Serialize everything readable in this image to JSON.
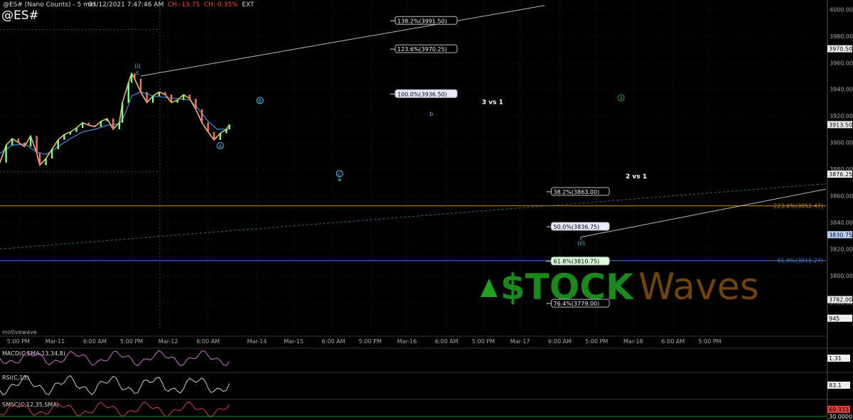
{
  "header": {
    "title": "@ES# (Nano Counts) - 5 min",
    "datetime": "03/12/2021 7:47:46 AM",
    "change": "CH:-13.75",
    "change_pct": "CH:-0.35%",
    "session": "EXT",
    "symbol": "@ES#"
  },
  "colors": {
    "background": "#000000",
    "up": "#7cff7c",
    "down": "#ff7070",
    "fib_box_border": "#cccccc",
    "orange_line": "#c88a1a",
    "blue_line": "#4a7bd0",
    "wave_label": "#4fc3f7",
    "watermark_green": "#1fa01f",
    "watermark_brown": "#7a4b10"
  },
  "watermark": {
    "site": "motivewave",
    "brand_left": "$TOCK",
    "brand_right": "Waves"
  },
  "chart_data": {
    "type": "candlestick",
    "y_axis": {
      "range": [
        3762,
        4005
      ],
      "ticks": [
        "4000.00",
        "3980.00",
        "3960.00",
        "3940.00",
        "3920.00",
        "3900.00",
        "3880.00",
        "3860.00",
        "3840.00",
        "3820.00",
        "3800.00",
        "3780.00"
      ],
      "tick_values": [
        4000,
        3980,
        3960,
        3940,
        3920,
        3900,
        3880,
        3860,
        3840,
        3820,
        3800,
        3780
      ]
    },
    "price_labels": [
      {
        "text": "3970.50",
        "value": 3970.5,
        "style": "white"
      },
      {
        "text": "3913.50",
        "value": 3913.5,
        "style": "white"
      },
      {
        "text": "3876.25",
        "value": 3876.25,
        "style": "white"
      },
      {
        "text": "3830.75",
        "value": 3830.75,
        "style": "blue"
      },
      {
        "text": "3782.00",
        "value": 3782,
        "style": "white"
      },
      {
        "text": "945",
        "value": 3768,
        "style": "white"
      }
    ],
    "x_ticks": [
      {
        "label": "5:00 PM",
        "t": 6
      },
      {
        "label": "Mar-11",
        "t": 18
      },
      {
        "label": "6:00 AM",
        "t": 31
      },
      {
        "label": "5:00 PM",
        "t": 43
      },
      {
        "label": "Mar-12",
        "t": 55
      },
      {
        "label": "6:00 AM",
        "t": 68
      },
      {
        "label": "Mar-14",
        "t": 84
      },
      {
        "label": "Mar-15",
        "t": 96
      },
      {
        "label": "6:00 AM",
        "t": 109
      },
      {
        "label": "5:00 PM",
        "t": 121
      },
      {
        "label": "Mar-16",
        "t": 133
      },
      {
        "label": "6:00 AM",
        "t": 146
      },
      {
        "label": "5:00 PM",
        "t": 158
      },
      {
        "label": "Mar-17",
        "t": 170
      },
      {
        "label": "6:00 AM",
        "t": 183
      },
      {
        "label": "5:00 PM",
        "t": 195
      },
      {
        "label": "Mar-18",
        "t": 207
      },
      {
        "label": "6:00 AM",
        "t": 220
      },
      {
        "label": "5:00 PM",
        "t": 232
      }
    ],
    "price_path": [
      [
        0,
        3885
      ],
      [
        2,
        3898
      ],
      [
        4,
        3903
      ],
      [
        6,
        3900
      ],
      [
        8,
        3897
      ],
      [
        10,
        3905
      ],
      [
        12,
        3892
      ],
      [
        13,
        3883
      ],
      [
        15,
        3888
      ],
      [
        17,
        3895
      ],
      [
        19,
        3902
      ],
      [
        21,
        3906
      ],
      [
        23,
        3908
      ],
      [
        25,
        3911
      ],
      [
        27,
        3915
      ],
      [
        29,
        3913
      ],
      [
        31,
        3912
      ],
      [
        33,
        3916
      ],
      [
        35,
        3918
      ],
      [
        37,
        3910
      ],
      [
        39,
        3915
      ],
      [
        40,
        3930
      ],
      [
        42,
        3945
      ],
      [
        43,
        3952
      ],
      [
        44,
        3948
      ],
      [
        46,
        3938
      ],
      [
        48,
        3930
      ],
      [
        50,
        3935
      ],
      [
        52,
        3938
      ],
      [
        54,
        3936
      ],
      [
        56,
        3930
      ],
      [
        58,
        3932
      ],
      [
        60,
        3936
      ],
      [
        62,
        3933
      ],
      [
        64,
        3925
      ],
      [
        66,
        3915
      ],
      [
        68,
        3908
      ],
      [
        70,
        3902
      ],
      [
        72,
        3907
      ],
      [
        74,
        3910
      ],
      [
        75,
        3913.5
      ]
    ],
    "ma_path": [
      [
        0,
        3892
      ],
      [
        4,
        3898
      ],
      [
        8,
        3899
      ],
      [
        12,
        3893
      ],
      [
        15,
        3891
      ],
      [
        19,
        3897
      ],
      [
        23,
        3903
      ],
      [
        27,
        3908
      ],
      [
        31,
        3910
      ],
      [
        35,
        3913
      ],
      [
        39,
        3914
      ],
      [
        41,
        3922
      ],
      [
        43,
        3935
      ],
      [
        46,
        3938
      ],
      [
        50,
        3935
      ],
      [
        54,
        3934
      ],
      [
        58,
        3933
      ],
      [
        62,
        3932
      ],
      [
        65,
        3925
      ],
      [
        68,
        3916
      ],
      [
        71,
        3910
      ],
      [
        75,
        3910
      ]
    ],
    "fib_levels": [
      {
        "label": "138.2%(3991.50)",
        "value": 3991.5,
        "t": 145,
        "style": "white"
      },
      {
        "label": "123.6%(3970.25)",
        "value": 3970.25,
        "t": 145,
        "style": "white"
      },
      {
        "label": "100.0%(3936.50)",
        "value": 3936.5,
        "t": 145,
        "style": "hl"
      },
      {
        "label": "38.2%(3863.00)",
        "value": 3863,
        "t": 196,
        "style": "white"
      },
      {
        "label": "50.0%(3836.75)",
        "value": 3836.75,
        "t": 196,
        "style": "hl"
      },
      {
        "label": "61.8%(3810.75)",
        "value": 3810.75,
        "t": 196,
        "style": "green"
      },
      {
        "label": "76.4%(3779.00)",
        "value": 3779,
        "t": 196,
        "style": "white"
      }
    ],
    "horizontal_lines": [
      {
        "label": "223.6%(3852.47)",
        "value": 3852.47,
        "color": "orange"
      },
      {
        "label": "61.8%(3811.27)",
        "value": 3811.27,
        "color": "blue"
      }
    ],
    "annotations": [
      {
        "text": "3 vs 1",
        "value": 3929,
        "t": 161
      },
      {
        "text": "2 vs 1",
        "value": 3873,
        "t": 208
      }
    ],
    "wave_labels": [
      {
        "text": "(i)",
        "value": 3956,
        "t": 45,
        "circled": false
      },
      {
        "text": "c",
        "value": 3951,
        "t": 45,
        "circled": false
      },
      {
        "text": "B",
        "value": 3930,
        "t": 85,
        "circled": true
      },
      {
        "text": "A",
        "value": 3896,
        "t": 72,
        "circled": true
      },
      {
        "text": "b",
        "value": 3920,
        "t": 141,
        "circled": false
      },
      {
        "text": "C",
        "value": 3875,
        "t": 111,
        "circled": true
      },
      {
        "text": "a",
        "value": 3871,
        "t": 111,
        "circled": false
      },
      {
        "text": "c",
        "value": 3827,
        "t": 190,
        "circled": false
      },
      {
        "text": "(ii)",
        "value": 3823,
        "t": 190,
        "circled": false
      },
      {
        "text": "4",
        "value": 3932,
        "t": 203,
        "circled": true
      }
    ],
    "trendlines": [
      {
        "from": [
          46,
          3950
        ],
        "to": [
          178,
          4003
        ],
        "style": "solid"
      },
      {
        "from": [
          190,
          3829
        ],
        "to": [
          270,
          3865
        ],
        "style": "solid"
      },
      {
        "from": [
          0,
          3820
        ],
        "to": [
          270,
          3869
        ],
        "style": "dashed"
      }
    ],
    "indicators": [
      {
        "name": "MACD(C,EMA,13,34,8)",
        "value_label": "1.31"
      },
      {
        "name": "RSI(C,13)",
        "value_label": "83.1"
      },
      {
        "name": "SMSC(C,12,35,SMA)",
        "value_label": "69.333",
        "level_label": "30.0000"
      }
    ]
  }
}
